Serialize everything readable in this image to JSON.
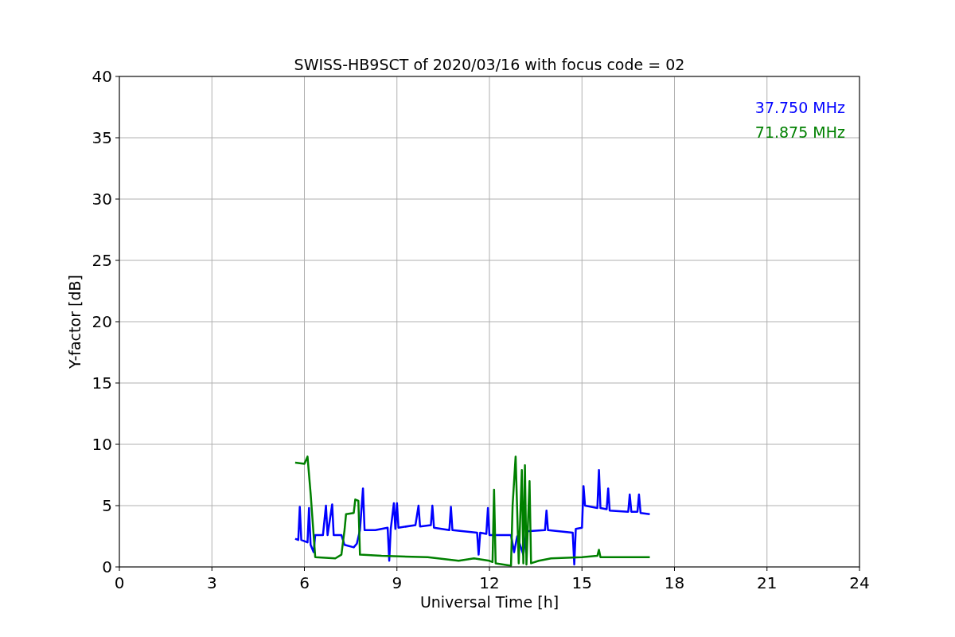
{
  "chart_data": {
    "type": "line",
    "title": "SWISS-HB9SCT of 2020/03/16 with focus code = 02",
    "xlabel": "Universal Time [h]",
    "ylabel": "Y-factor [dB]",
    "xlim": [
      0,
      24
    ],
    "ylim": [
      0,
      40
    ],
    "xticks": [
      0,
      3,
      6,
      9,
      12,
      15,
      18,
      21,
      24
    ],
    "yticks": [
      0,
      5,
      10,
      15,
      20,
      25,
      30,
      35,
      40
    ],
    "grid": true,
    "series": [
      {
        "name": "37.750 MHz",
        "color": "#0000ff",
        "x": [
          5.7,
          5.8,
          5.85,
          5.9,
          6.1,
          6.15,
          6.2,
          6.3,
          6.35,
          6.6,
          6.7,
          6.75,
          6.9,
          6.95,
          7.2,
          7.3,
          7.6,
          7.7,
          7.8,
          7.9,
          7.95,
          8.3,
          8.7,
          8.75,
          8.8,
          8.9,
          8.95,
          9.0,
          9.05,
          9.6,
          9.7,
          9.75,
          10.1,
          10.15,
          10.2,
          10.7,
          10.75,
          10.8,
          11.6,
          11.65,
          11.7,
          11.9,
          11.95,
          12.0,
          12.7,
          12.8,
          12.9,
          13.1,
          13.2,
          13.8,
          13.85,
          13.9,
          14.7,
          14.75,
          14.8,
          15.0,
          15.05,
          15.1,
          15.5,
          15.55,
          15.6,
          15.8,
          15.85,
          15.9,
          16.5,
          16.55,
          16.6,
          16.8,
          16.85,
          16.9,
          17.2
        ],
        "values": [
          2.3,
          2.2,
          4.9,
          2.2,
          2.0,
          4.8,
          1.8,
          1.2,
          2.6,
          2.6,
          5.0,
          2.6,
          5.1,
          2.6,
          2.6,
          1.8,
          1.6,
          1.9,
          3.0,
          6.4,
          3.0,
          3.0,
          3.2,
          0.5,
          3.1,
          5.2,
          3.1,
          5.2,
          3.2,
          3.4,
          5.0,
          3.3,
          3.4,
          5.0,
          3.2,
          3.0,
          4.9,
          3.0,
          2.8,
          1.0,
          2.8,
          2.7,
          4.8,
          2.6,
          2.6,
          1.2,
          2.5,
          1.0,
          2.9,
          3.0,
          4.6,
          3.0,
          2.8,
          0.2,
          3.1,
          3.2,
          6.6,
          5.0,
          4.8,
          7.9,
          4.8,
          4.7,
          6.4,
          4.6,
          4.5,
          5.9,
          4.5,
          4.5,
          5.9,
          4.4,
          4.3
        ]
      },
      {
        "name": "71.875 MHz",
        "color": "#008000",
        "x": [
          5.7,
          6.0,
          6.1,
          6.2,
          6.35,
          7.0,
          7.2,
          7.3,
          7.35,
          7.6,
          7.65,
          7.75,
          7.8,
          8.5,
          10.0,
          11.0,
          11.5,
          12.0,
          12.1,
          12.15,
          12.2,
          12.7,
          12.75,
          12.85,
          12.95,
          13.05,
          13.1,
          13.15,
          13.2,
          13.3,
          13.35,
          13.6,
          14.0,
          15.0,
          15.5,
          15.55,
          15.6,
          16.5,
          17.2
        ],
        "values": [
          8.5,
          8.4,
          9.0,
          6.0,
          0.8,
          0.7,
          1.0,
          3.0,
          4.3,
          4.4,
          5.5,
          5.4,
          1.0,
          0.9,
          0.8,
          0.5,
          0.7,
          0.5,
          0.4,
          6.3,
          0.3,
          0.1,
          5.0,
          9.0,
          0.3,
          7.9,
          0.3,
          8.3,
          0.2,
          7.0,
          0.3,
          0.5,
          0.7,
          0.8,
          0.9,
          1.4,
          0.8,
          0.8,
          0.8
        ]
      }
    ]
  }
}
